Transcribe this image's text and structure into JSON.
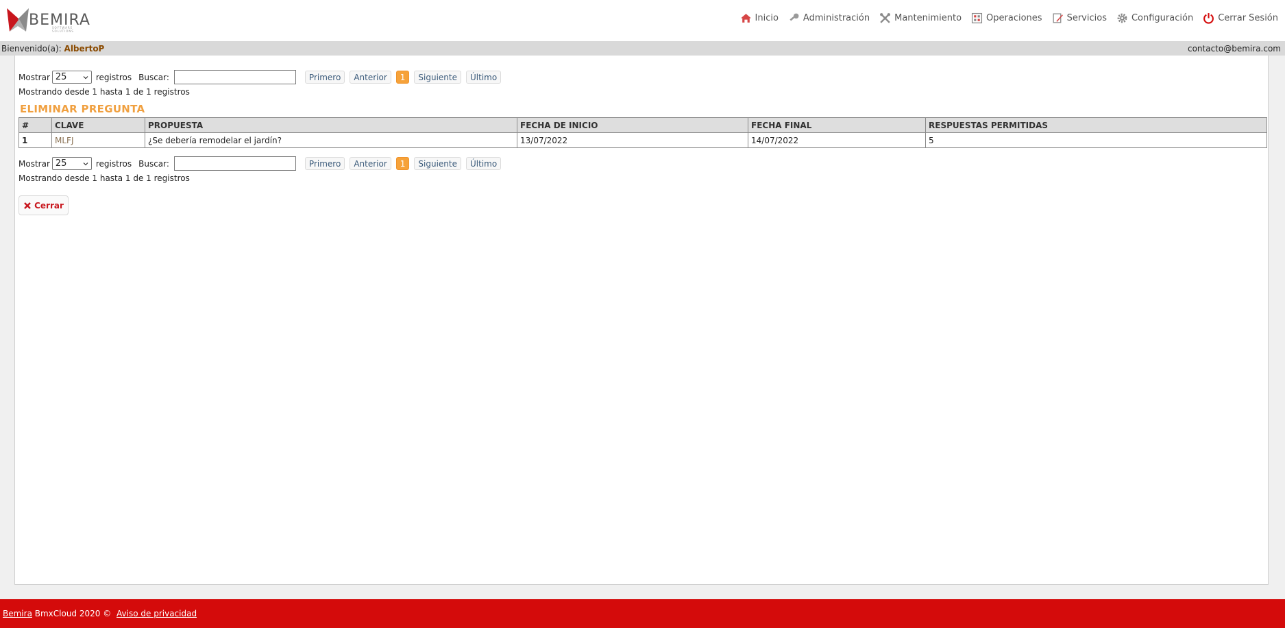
{
  "brand": {
    "name": "BEMIRA",
    "tagline": "SOFTWARE SOLUTIONS"
  },
  "nav": [
    {
      "label": "Inicio",
      "icon": "home-icon"
    },
    {
      "label": "Administración",
      "icon": "key-icon"
    },
    {
      "label": "Mantenimiento",
      "icon": "tools-icon"
    },
    {
      "label": "Operaciones",
      "icon": "calculator-icon"
    },
    {
      "label": "Servicios",
      "icon": "edit-document-icon"
    },
    {
      "label": "Configuración",
      "icon": "gear-icon"
    },
    {
      "label": "Cerrar Sesión",
      "icon": "power-icon"
    }
  ],
  "welcome": {
    "prefix": "Bienvenido(a):",
    "user": "AlbertoP",
    "email": "contacto@bemira.com"
  },
  "controls": {
    "show_label": "Mostrar",
    "page_size": "25",
    "records_label": "registros",
    "search_label": "Buscar:",
    "search_value": "",
    "pager": {
      "first": "Primero",
      "prev": "Anterior",
      "current": "1",
      "next": "Siguiente",
      "last": "Último"
    },
    "info": "Mostrando desde 1 hasta 1 de 1 registros"
  },
  "title": "ELIMINAR PREGUNTA",
  "table": {
    "headers": [
      "#",
      "CLAVE",
      "PROPUESTA",
      "FECHA DE INICIO",
      "FECHA FINAL",
      "RESPUESTAS PERMITIDAS"
    ],
    "rows": [
      [
        "1",
        "MLFJ",
        "¿Se debería remodelar el jardín?",
        "13/07/2022",
        "14/07/2022",
        "5"
      ]
    ]
  },
  "close_label": "Cerrar",
  "footer": {
    "link": "Bemira",
    "text": " BmxCloud 2020 © ",
    "privacy": "Aviso de privacidad"
  },
  "colors": {
    "accent": "#c8161d",
    "title": "#f0a040",
    "active_page": "#f6a23a",
    "footer": "#d40b0b"
  }
}
